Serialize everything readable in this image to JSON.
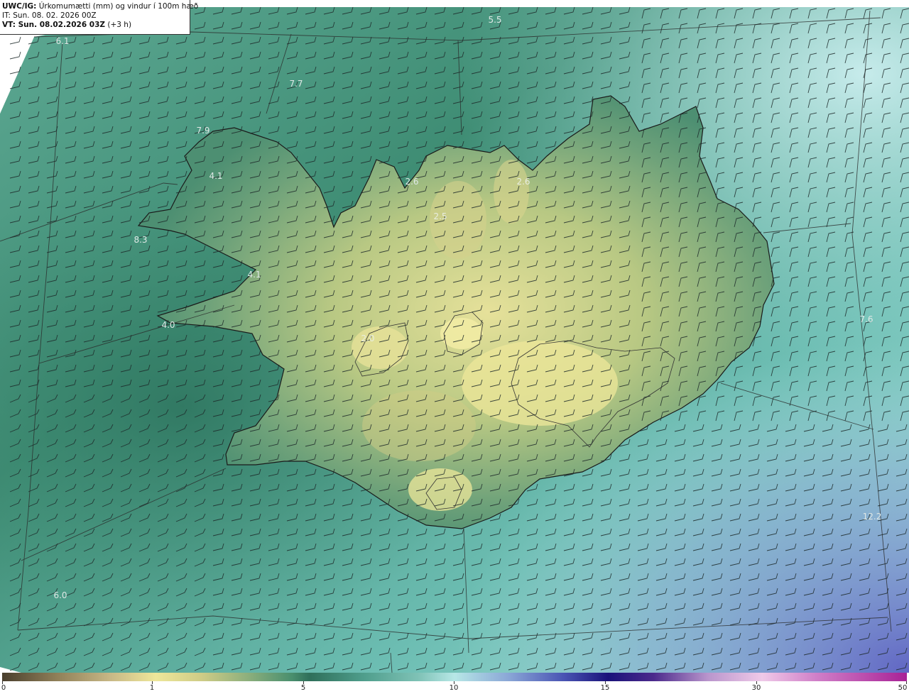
{
  "header": {
    "model": "UWC/IG:",
    "title": "Úrkomumætti (mm) og vindur í 100m hæð",
    "it_prefix": "IT:",
    "it_value": "Sun. 08. 02. 2026 00Z",
    "vt_prefix": "VT: Sun. 08.02.2026 03Z",
    "vt_suffix": "(+3 h)"
  },
  "map_labels": [
    "5.5",
    "6.1",
    "7.7",
    "7.9",
    "4.1",
    "8.3",
    "4.1",
    "2.6",
    "2.5",
    "4.0",
    "2.0",
    "2.6",
    "7.6",
    "12.2",
    "6.0"
  ],
  "colorbar": {
    "ticks": [
      "0",
      "1",
      "5",
      "10",
      "15",
      "30",
      "50"
    ],
    "colors": [
      "#4a3f2d",
      "#eee79a",
      "#2f6f5a",
      "#b7e7e6",
      "#1a127a",
      "#efc9e8",
      "#a82296"
    ]
  },
  "map_colors": {
    "sea_dark": "#3e8a72",
    "sea_light": "#a9e0da",
    "land_high": "#e8e39a",
    "land_mid": "#7fb07a",
    "southeast_purple": "#6a72c8"
  }
}
